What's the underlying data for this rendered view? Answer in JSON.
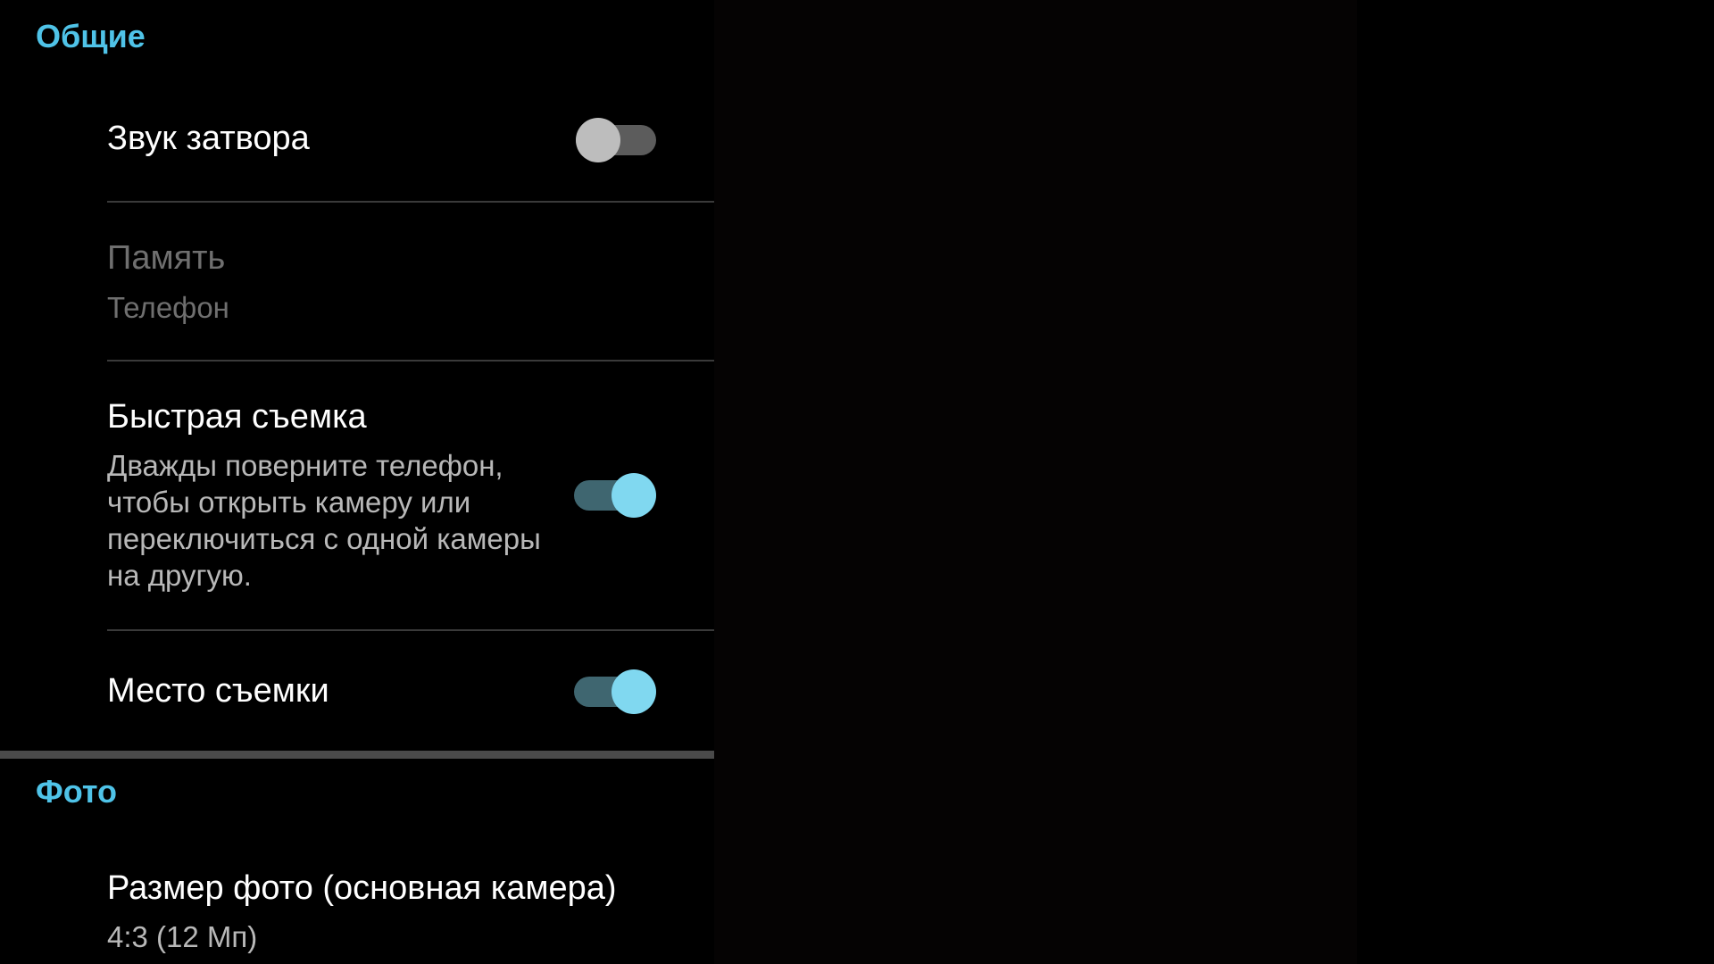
{
  "sections": {
    "general": {
      "header": "Общие"
    },
    "photo": {
      "header": "Фото"
    }
  },
  "prefs": {
    "shutter_sound": {
      "title": "Звук затвора",
      "enabled": false
    },
    "storage": {
      "title": "Память",
      "summary": "Телефон"
    },
    "quick_capture": {
      "title": "Быстрая съемка",
      "summary": "Дважды поверните телефон, чтобы открыть камеру или переключиться с одной камеры на другую.",
      "enabled": true
    },
    "location": {
      "title": "Место съемки",
      "enabled": true
    },
    "photo_size": {
      "title": "Размер фото (основная камера)",
      "summary": "4:3 (12 Мп)"
    }
  },
  "colors": {
    "accent": "#4fc3e8",
    "switch_on_thumb": "#80d8f0",
    "switch_on_track": "#3f6670",
    "switch_off_thumb": "#bdbdbd",
    "switch_off_track": "#5c5c5c"
  }
}
